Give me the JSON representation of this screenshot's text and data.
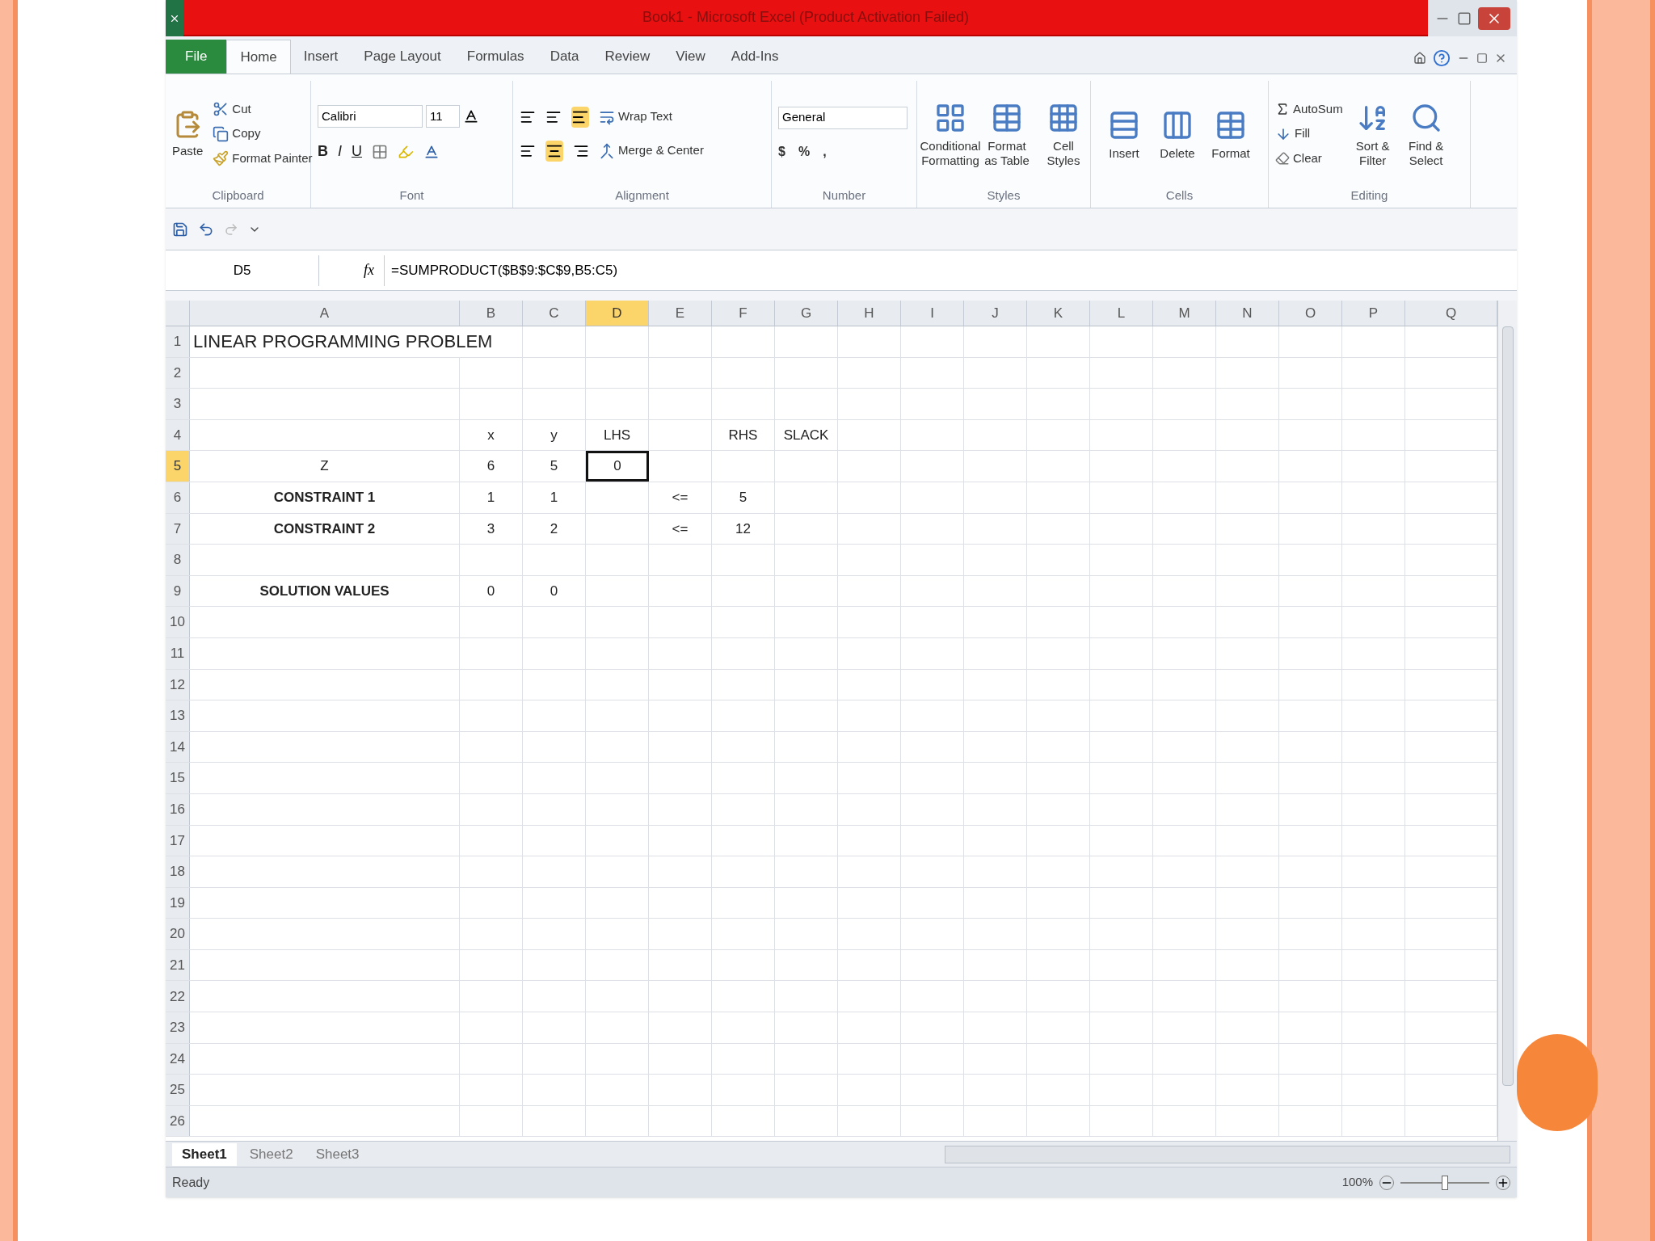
{
  "window": {
    "title": "Book1 - Microsoft Excel (Product Activation Failed)"
  },
  "ribbon_tabs": [
    {
      "label": "File",
      "kind": "file",
      "selected": false
    },
    {
      "label": "Home",
      "kind": "tab",
      "selected": true
    },
    {
      "label": "Insert",
      "kind": "tab",
      "selected": false
    },
    {
      "label": "Page Layout",
      "kind": "tab",
      "selected": false
    },
    {
      "label": "Formulas",
      "kind": "tab",
      "selected": false
    },
    {
      "label": "Data",
      "kind": "tab",
      "selected": false
    },
    {
      "label": "Review",
      "kind": "tab",
      "selected": false
    },
    {
      "label": "View",
      "kind": "tab",
      "selected": false
    },
    {
      "label": "Add-Ins",
      "kind": "tab",
      "selected": false
    }
  ],
  "clipboard": {
    "label": "Clipboard",
    "paste": "Paste",
    "commands": [
      "Cut",
      "Copy",
      "Format Painter"
    ]
  },
  "font": {
    "label": "Font",
    "font_name": "Calibri",
    "font_size": "11",
    "buttons": [
      "B",
      "I",
      "U"
    ]
  },
  "alignment": {
    "label": "Alignment",
    "commands": [
      "Wrap Text",
      "Merge & Center"
    ]
  },
  "number": {
    "label": "Number",
    "format": "General",
    "symbols": [
      "$",
      "%",
      ","
    ]
  },
  "styles": {
    "label": "Styles",
    "commands": [
      "Conditional Formatting",
      "Format as Table",
      "Cell Styles"
    ]
  },
  "cells_group": {
    "label": "Cells",
    "commands": [
      "Insert",
      "Delete",
      "Format"
    ]
  },
  "editing": {
    "label": "Editing",
    "commands": [
      "AutoSum",
      "Fill",
      "Clear"
    ],
    "big_commands": [
      "Sort & Filter",
      "Find & Select"
    ]
  },
  "formula_bar": {
    "name_box": "D5",
    "fx": "fx",
    "formula": "=SUMPRODUCT($B$9:$C$9,B5:C5)"
  },
  "columns": [
    {
      "label": "A",
      "selected": false
    },
    {
      "label": "B",
      "selected": false
    },
    {
      "label": "C",
      "selected": false
    },
    {
      "label": "D",
      "selected": true
    },
    {
      "label": "E",
      "selected": false
    },
    {
      "label": "F",
      "selected": false
    },
    {
      "label": "G",
      "selected": false
    },
    {
      "label": "H",
      "selected": false
    },
    {
      "label": "I",
      "selected": false
    },
    {
      "label": "J",
      "selected": false
    },
    {
      "label": "K",
      "selected": false
    },
    {
      "label": "L",
      "selected": false
    },
    {
      "label": "M",
      "selected": false
    },
    {
      "label": "N",
      "selected": false
    },
    {
      "label": "O",
      "selected": false
    },
    {
      "label": "P",
      "selected": false
    },
    {
      "label": "Q",
      "selected": false
    }
  ],
  "rows": [
    {
      "number": "1",
      "selected": false,
      "cells": [
        {
          "text": "LINEAR PROGRAMMING PROBLEM",
          "kind": "title",
          "active": false
        }
      ]
    },
    {
      "number": "2",
      "selected": false,
      "cells": []
    },
    {
      "number": "3",
      "selected": false,
      "cells": []
    },
    {
      "number": "4",
      "selected": false,
      "cells": [
        null,
        {
          "text": "x",
          "kind": "plain",
          "active": false
        },
        {
          "text": "y",
          "kind": "plain",
          "active": false
        },
        {
          "text": "LHS",
          "kind": "plain",
          "active": false
        },
        null,
        {
          "text": "RHS",
          "kind": "plain",
          "active": false
        },
        {
          "text": "SLACK",
          "kind": "plain",
          "active": false
        }
      ]
    },
    {
      "number": "5",
      "selected": true,
      "cells": [
        {
          "text": "Z",
          "kind": "plain",
          "active": false
        },
        {
          "text": "6",
          "kind": "plain",
          "active": false
        },
        {
          "text": "5",
          "kind": "plain",
          "active": false
        },
        {
          "text": "0",
          "kind": "plain",
          "active": true
        }
      ]
    },
    {
      "number": "6",
      "selected": false,
      "cells": [
        {
          "text": "CONSTRAINT 1",
          "kind": "bold",
          "active": false
        },
        {
          "text": "1",
          "kind": "plain",
          "active": false
        },
        {
          "text": "1",
          "kind": "plain",
          "active": false
        },
        null,
        {
          "text": "<=",
          "kind": "plain",
          "active": false
        },
        {
          "text": "5",
          "kind": "plain",
          "active": false
        }
      ]
    },
    {
      "number": "7",
      "selected": false,
      "cells": [
        {
          "text": "CONSTRAINT 2",
          "kind": "bold",
          "active": false
        },
        {
          "text": "3",
          "kind": "plain",
          "active": false
        },
        {
          "text": "2",
          "kind": "plain",
          "active": false
        },
        null,
        {
          "text": "<=",
          "kind": "plain",
          "active": false
        },
        {
          "text": "12",
          "kind": "plain",
          "active": false
        }
      ]
    },
    {
      "number": "8",
      "selected": false,
      "cells": []
    },
    {
      "number": "9",
      "selected": false,
      "cells": [
        {
          "text": "SOLUTION VALUES",
          "kind": "bold",
          "active": false
        },
        {
          "text": "0",
          "kind": "plain",
          "active": false
        },
        {
          "text": "0",
          "kind": "plain",
          "active": false
        }
      ]
    },
    {
      "number": "10",
      "selected": false,
      "cells": []
    },
    {
      "number": "11",
      "selected": false,
      "cells": []
    },
    {
      "number": "12",
      "selected": false,
      "cells": []
    },
    {
      "number": "13",
      "selected": false,
      "cells": []
    },
    {
      "number": "14",
      "selected": false,
      "cells": []
    },
    {
      "number": "15",
      "selected": false,
      "cells": []
    },
    {
      "number": "16",
      "selected": false,
      "cells": []
    },
    {
      "number": "17",
      "selected": false,
      "cells": []
    },
    {
      "number": "18",
      "selected": false,
      "cells": []
    },
    {
      "number": "19",
      "selected": false,
      "cells": []
    },
    {
      "number": "20",
      "selected": false,
      "cells": []
    },
    {
      "number": "21",
      "selected": false,
      "cells": []
    },
    {
      "number": "22",
      "selected": false,
      "cells": []
    },
    {
      "number": "23",
      "selected": false,
      "cells": []
    },
    {
      "number": "24",
      "selected": false,
      "cells": []
    },
    {
      "number": "25",
      "selected": false,
      "cells": []
    },
    {
      "number": "26",
      "selected": false,
      "cells": []
    }
  ],
  "sheet_tabs": [
    {
      "label": "Sheet1",
      "selected": true
    },
    {
      "label": "Sheet2",
      "selected": false
    },
    {
      "label": "Sheet3",
      "selected": false
    }
  ],
  "status_bar": {
    "status": "Ready",
    "zoom": "100%",
    "zoom_slider": {
      "level": 0.5
    }
  }
}
